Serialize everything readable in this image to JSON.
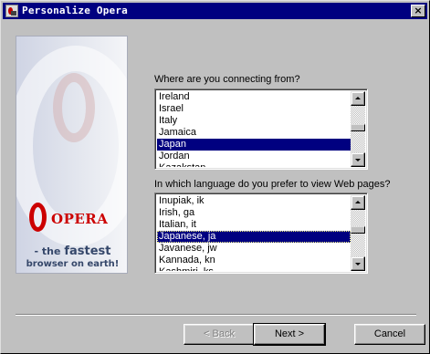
{
  "window": {
    "title": "Personalize Opera",
    "close_label": "×"
  },
  "banner": {
    "logo_text": "OPERA",
    "tagline_prefix": "- the ",
    "tagline_emphasis": "fastest",
    "tagline_line2": "browser on earth!"
  },
  "connection": {
    "prompt": "Where are you connecting from?",
    "items": [
      "Ireland",
      "Israel",
      "Italy",
      "Jamaica",
      "Japan",
      "Jordan",
      "Kazakstan"
    ],
    "selected": "Japan"
  },
  "language": {
    "prompt": "In which language do you prefer to view Web pages?",
    "items": [
      "Inupiak, ik",
      "Irish, ga",
      "Italian, it",
      "Japanese, ja",
      "Javanese, jw",
      "Kannada, kn",
      "Kashmiri, ks"
    ],
    "selected": "Japanese, ja"
  },
  "buttons": {
    "back": "< Back",
    "next": "Next >",
    "cancel": "Cancel"
  }
}
